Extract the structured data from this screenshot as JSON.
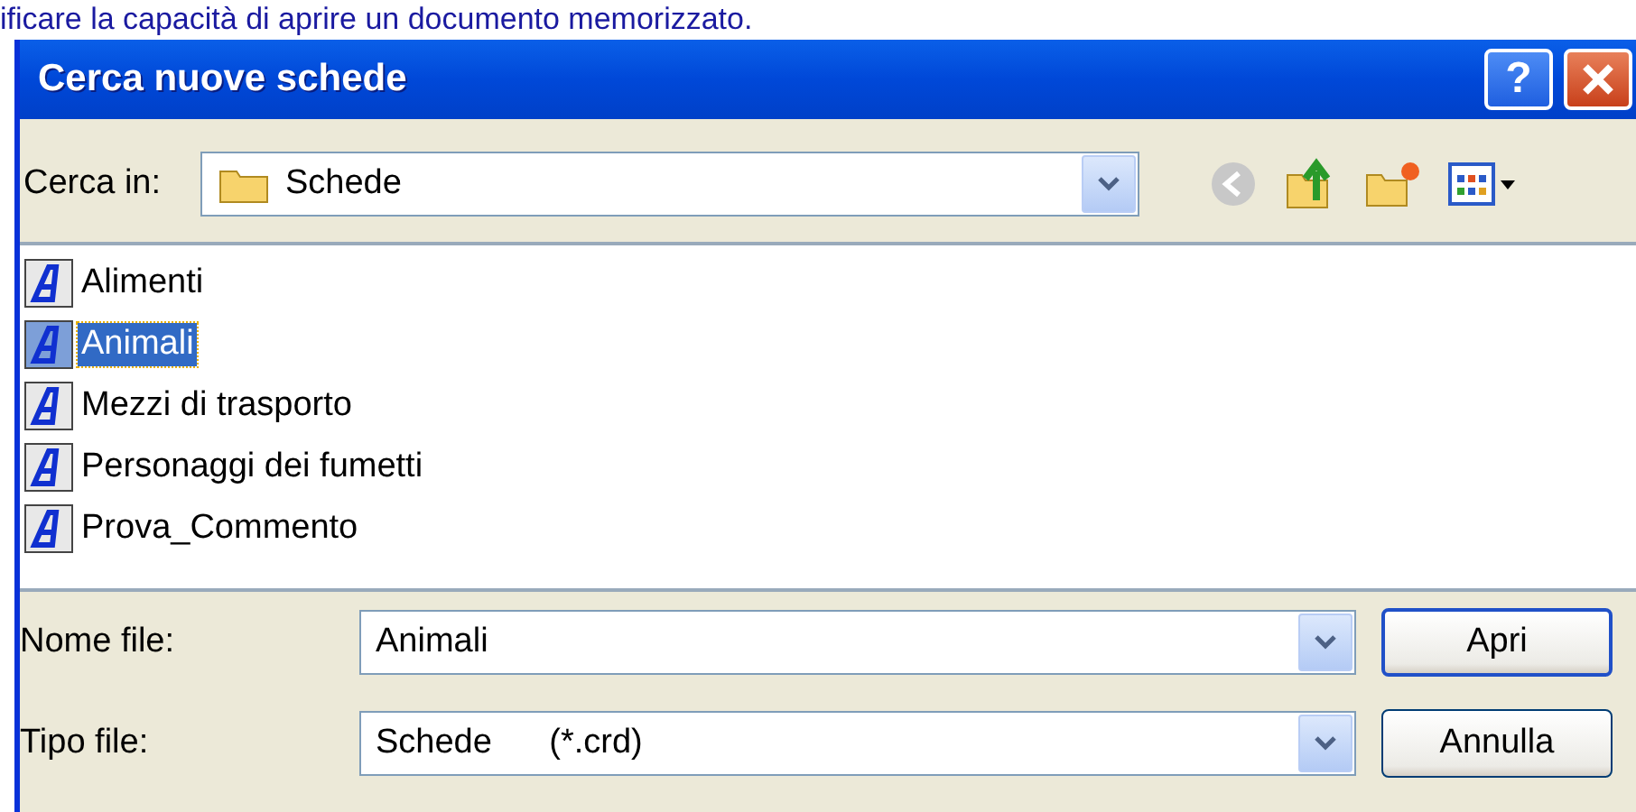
{
  "caption": "ificare la capacità di aprire un documento memorizzato.",
  "window": {
    "title": "Cerca nuove schede",
    "help": "?"
  },
  "look_in": {
    "label": "Cerca in:",
    "value": "Schede"
  },
  "files": [
    {
      "name": "Alimenti",
      "selected": false
    },
    {
      "name": "Animali",
      "selected": true
    },
    {
      "name": "Mezzi di trasporto",
      "selected": false
    },
    {
      "name": "Personaggi dei fumetti",
      "selected": false
    },
    {
      "name": "Prova_Commento",
      "selected": false
    }
  ],
  "fields": [
    {
      "label": "Nome file:",
      "value": "Animali",
      "button": "Apri",
      "default": true
    },
    {
      "label": "Tipo file:",
      "value": "Schede      (*.crd)",
      "button": "Annulla",
      "default": false
    }
  ]
}
